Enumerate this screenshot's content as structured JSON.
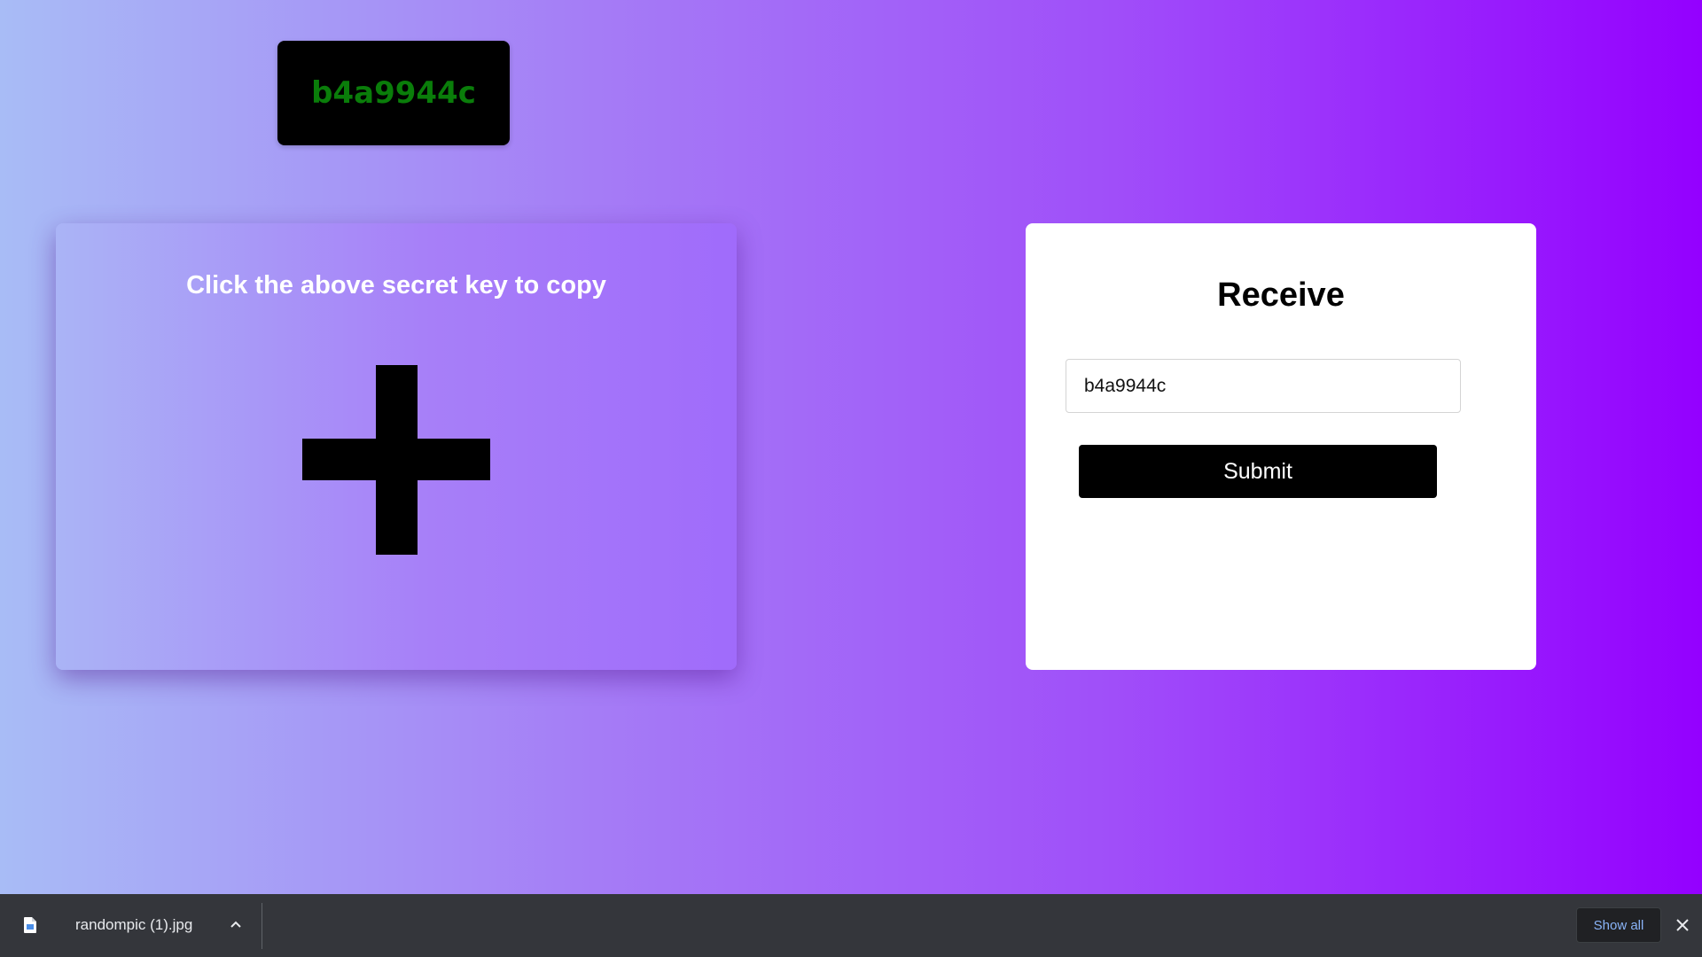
{
  "secret_key": {
    "value": "b4a9944c",
    "text_color": "#0a7d0a"
  },
  "upload_card": {
    "title": "Click the above secret key to copy",
    "icon": "plus-icon"
  },
  "receive_card": {
    "title": "Receive",
    "input_value": "b4a9944c",
    "submit_label": "Submit"
  },
  "download_bar": {
    "file_icon": "image-file-icon",
    "file_name": "randompic (1).jpg",
    "chevron_icon": "chevron-up-icon",
    "show_all_label": "Show all",
    "close_icon": "close-icon"
  },
  "colors": {
    "gradient_start": "#a8bcf6",
    "gradient_end": "#9400ff",
    "download_bar": "#34363b",
    "link_blue": "#8ab4f8"
  }
}
